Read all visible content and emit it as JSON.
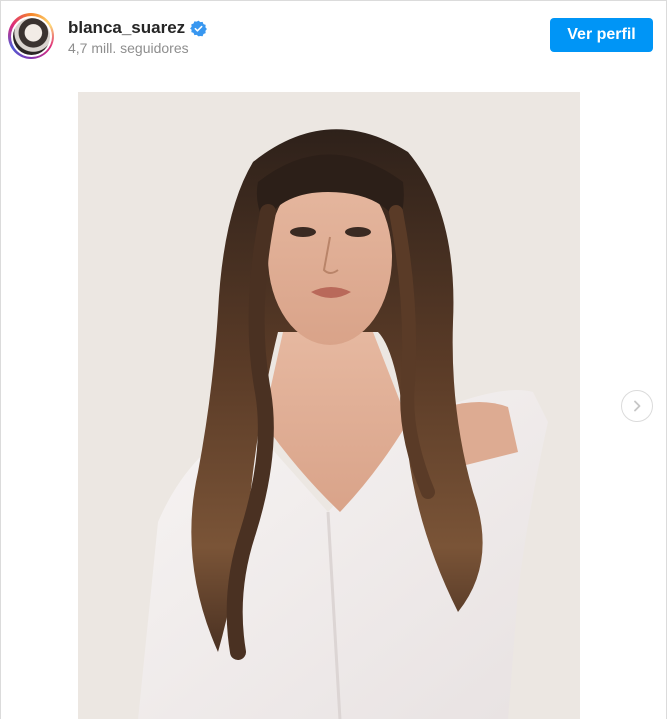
{
  "post": {
    "username": "blanca_suarez",
    "verified": true,
    "followers": "4,7 mill. seguidores",
    "profile_button": "Ver perfil"
  },
  "icons": {
    "verified": "verified-badge-icon",
    "next": "chevron-right-icon"
  },
  "colors": {
    "primary_button": "#0095f6",
    "verified_badge": "#3897f0",
    "username": "#262626",
    "secondary_text": "#8e8e8e"
  }
}
